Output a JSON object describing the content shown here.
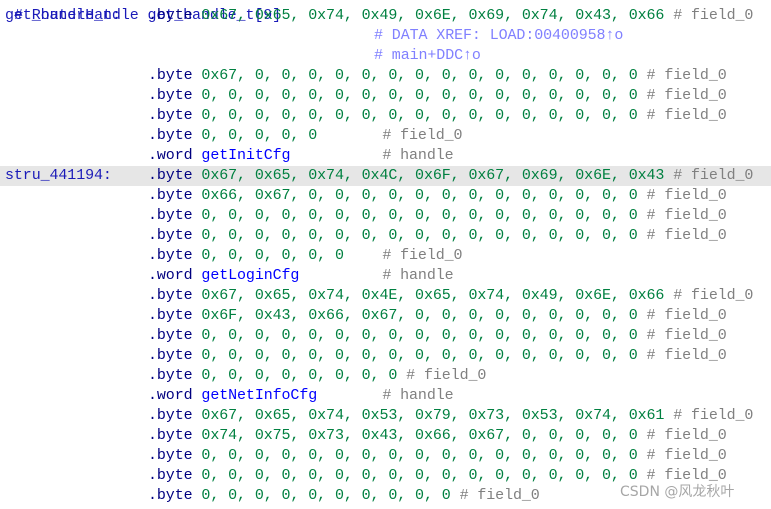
{
  "header_comment": "# RouterHandle get_handle_t[9]",
  "colors": {
    "label": "#1a1ab8",
    "mnemonic": "#000080",
    "number": "#008040",
    "name": "#0000ff",
    "comment": "#808080",
    "xref": "#8080ff",
    "highlight": "#e6e6e6"
  },
  "rows": [
    {
      "label": "get_handle_t:",
      "mnem": ".byte",
      "ops": "0x67, 0x65, 0x74, 0x49, 0x6E, 0x69, 0x74, 0x43, 0x66",
      "comment": "# field_0"
    },
    {
      "xref": "# DATA XREF: LOAD:00400958↑o"
    },
    {
      "xref": "# main+DDC↑o"
    },
    {
      "mnem": ".byte",
      "ops": "0x67, 0, 0, 0, 0, 0, 0, 0, 0, 0, 0, 0, 0, 0, 0, 0",
      "comment": "# field_0"
    },
    {
      "mnem": ".byte",
      "ops": "0, 0, 0, 0, 0, 0, 0, 0, 0, 0, 0, 0, 0, 0, 0, 0, 0",
      "comment": "# field_0"
    },
    {
      "mnem": ".byte",
      "ops": "0, 0, 0, 0, 0, 0, 0, 0, 0, 0, 0, 0, 0, 0, 0, 0, 0",
      "comment": "# field_0"
    },
    {
      "mnem": ".byte",
      "ops": "0, 0, 0, 0, 0",
      "comment": "# field_0"
    },
    {
      "mnem": ".word",
      "name": "getInitCfg",
      "comment": "# handle"
    },
    {
      "label": "stru_441194:",
      "mnem": ".byte",
      "ops": "0x67, 0x65, 0x74, 0x4C, 0x6F, 0x67, 0x69, 0x6E, 0x43",
      "comment": "# field_0",
      "highlight": true
    },
    {
      "mnem": ".byte",
      "ops": "0x66, 0x67, 0, 0, 0, 0, 0, 0, 0, 0, 0, 0, 0, 0, 0",
      "comment": "# field_0"
    },
    {
      "mnem": ".byte",
      "ops": "0, 0, 0, 0, 0, 0, 0, 0, 0, 0, 0, 0, 0, 0, 0, 0, 0",
      "comment": "# field_0"
    },
    {
      "mnem": ".byte",
      "ops": "0, 0, 0, 0, 0, 0, 0, 0, 0, 0, 0, 0, 0, 0, 0, 0, 0",
      "comment": "# field_0"
    },
    {
      "mnem": ".byte",
      "ops": "0, 0, 0, 0, 0, 0",
      "comment": "# field_0"
    },
    {
      "mnem": ".word",
      "name": "getLoginCfg",
      "comment": "# handle"
    },
    {
      "mnem": ".byte",
      "ops": "0x67, 0x65, 0x74, 0x4E, 0x65, 0x74, 0x49, 0x6E, 0x66",
      "comment": "# field_0"
    },
    {
      "mnem": ".byte",
      "ops": "0x6F, 0x43, 0x66, 0x67, 0, 0, 0, 0, 0, 0, 0, 0, 0",
      "comment": "# field_0"
    },
    {
      "mnem": ".byte",
      "ops": "0, 0, 0, 0, 0, 0, 0, 0, 0, 0, 0, 0, 0, 0, 0, 0, 0",
      "comment": "# field_0"
    },
    {
      "mnem": ".byte",
      "ops": "0, 0, 0, 0, 0, 0, 0, 0, 0, 0, 0, 0, 0, 0, 0, 0, 0",
      "comment": "# field_0"
    },
    {
      "mnem": ".byte",
      "ops": "0, 0, 0, 0, 0, 0, 0, 0",
      "comment": "# field_0"
    },
    {
      "mnem": ".word",
      "name": "getNetInfoCfg",
      "comment": "# handle"
    },
    {
      "mnem": ".byte",
      "ops": "0x67, 0x65, 0x74, 0x53, 0x79, 0x73, 0x53, 0x74, 0x61",
      "comment": "# field_0"
    },
    {
      "mnem": ".byte",
      "ops": "0x74, 0x75, 0x73, 0x43, 0x66, 0x67, 0, 0, 0, 0, 0",
      "comment": "# field_0"
    },
    {
      "mnem": ".byte",
      "ops": "0, 0, 0, 0, 0, 0, 0, 0, 0, 0, 0, 0, 0, 0, 0, 0, 0",
      "comment": "# field_0"
    },
    {
      "mnem": ".byte",
      "ops": "0, 0, 0, 0, 0, 0, 0, 0, 0, 0, 0, 0, 0, 0, 0, 0, 0",
      "comment": "# field_0"
    },
    {
      "mnem": ".byte",
      "ops": "0, 0, 0, 0, 0, 0, 0, 0, 0, 0",
      "comment": "# field_0"
    }
  ],
  "watermark": "CSDN @风龙秋叶"
}
